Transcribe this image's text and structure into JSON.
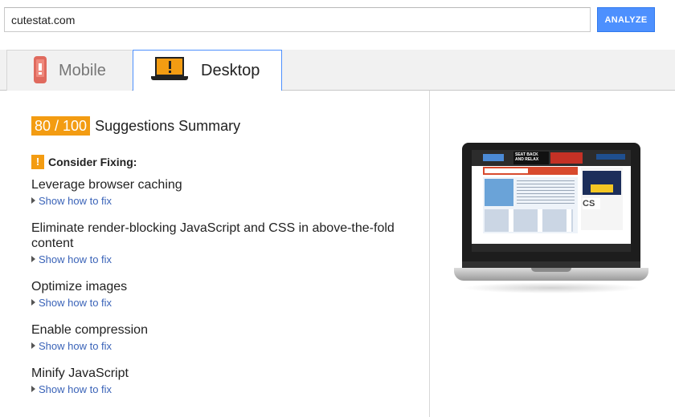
{
  "search": {
    "url_value": "cutestat.com",
    "analyze_label": "ANALYZE"
  },
  "tabs": [
    {
      "label": "Mobile",
      "icon": "phone-warning-icon",
      "active": false
    },
    {
      "label": "Desktop",
      "icon": "laptop-warning-icon",
      "active": true
    }
  ],
  "summary": {
    "score": "80 / 100",
    "title": "Suggestions Summary",
    "score_color": "#f39c12"
  },
  "consider": {
    "icon": "!",
    "label": "Consider Fixing:"
  },
  "suggestions": [
    {
      "title": "Leverage browser caching",
      "link": "Show how to fix"
    },
    {
      "title": "Eliminate render-blocking JavaScript and CSS in above-the-fold content",
      "link": "Show how to fix"
    },
    {
      "title": "Optimize images",
      "link": "Show how to fix"
    },
    {
      "title": "Enable compression",
      "link": "Show how to fix"
    },
    {
      "title": "Minify JavaScript",
      "link": "Show how to fix"
    }
  ],
  "preview": {
    "alt": "desktop-screenshot-preview",
    "screen_text": {
      "seat_back": "SEAT BACK AND RELAX",
      "cs_logo": "CS"
    }
  },
  "colors": {
    "accent_blue": "#4d90fe",
    "warning_orange": "#f39c12",
    "link_blue": "#3a63b8"
  }
}
